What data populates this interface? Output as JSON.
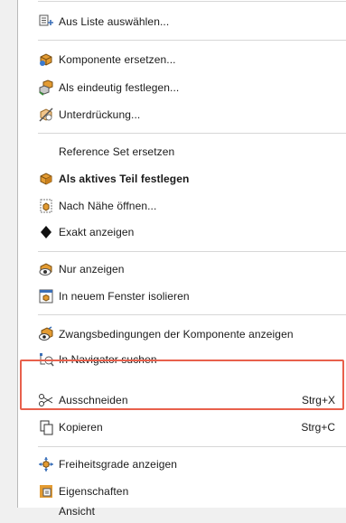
{
  "menu": {
    "items": [
      {
        "label": "Aus Liste auswählen...",
        "icon": "list-select-icon",
        "bold": false
      },
      {
        "label": "Komponente ersetzen...",
        "icon": "replace-component-icon",
        "bold": false
      },
      {
        "label": "Als eindeutig festlegen...",
        "icon": "make-unique-icon",
        "bold": false
      },
      {
        "label": "Unterdrückung...",
        "icon": "suppression-icon",
        "bold": false
      },
      {
        "label": "Reference Set ersetzen",
        "icon": "",
        "bold": false
      },
      {
        "label": "Als aktives Teil festlegen",
        "icon": "make-work-part-icon",
        "bold": true
      },
      {
        "label": "Nach Nähe öffnen...",
        "icon": "open-by-proximity-icon",
        "bold": false
      },
      {
        "label": "Exakt anzeigen",
        "icon": "diamond-icon",
        "bold": false
      },
      {
        "label": "Nur anzeigen",
        "icon": "show-only-icon",
        "bold": false
      },
      {
        "label": "In neuem Fenster isolieren",
        "icon": "isolate-window-icon",
        "bold": false
      },
      {
        "label": "Zwangsbedingungen der Komponente anzeigen",
        "icon": "show-constraints-icon",
        "bold": false
      },
      {
        "label": "In Navigator suchen",
        "icon": "find-in-navigator-icon",
        "bold": false
      },
      {
        "label": "Ausschneiden",
        "icon": "scissors-icon",
        "bold": false,
        "shortcut": "Strg+X"
      },
      {
        "label": "Kopieren",
        "icon": "copy-icon",
        "bold": false,
        "shortcut": "Strg+C"
      },
      {
        "label": "Freiheitsgrade anzeigen",
        "icon": "degrees-of-freedom-icon",
        "bold": false
      },
      {
        "label": "Eigenschaften",
        "icon": "properties-icon",
        "bold": false
      },
      {
        "label": "Ansicht",
        "icon": "",
        "bold": false
      }
    ]
  },
  "colors": {
    "highlight": "#e8604c",
    "menu_bg": "#ffffff",
    "separator": "#d7d7d7"
  }
}
